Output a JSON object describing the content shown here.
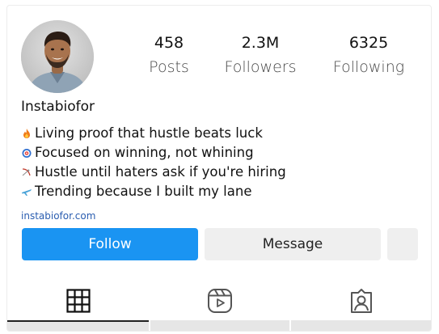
{
  "profile": {
    "username": "Instabiofor",
    "avatar_icon": "profile-photo",
    "stats": {
      "posts": {
        "value": "458",
        "label": "Posts"
      },
      "followers": {
        "value": "2.3M",
        "label": "Followers"
      },
      "following": {
        "value": "6325",
        "label": "Following"
      }
    },
    "bio": [
      {
        "emoji": "fire-icon",
        "text": "Living proof that hustle beats luck"
      },
      {
        "emoji": "target-icon",
        "text": "Focused on winning, not whining"
      },
      {
        "emoji": "bow-arrow-icon",
        "text": "Hustle until haters ask if you're hiring"
      },
      {
        "emoji": "airplane-icon",
        "text": "Trending because I built my lane"
      }
    ],
    "website": "instabiofor.com"
  },
  "actions": {
    "follow_label": "Follow",
    "message_label": "Message",
    "more_icon": "blank"
  },
  "tabs": [
    {
      "name": "posts-grid",
      "icon": "grid-icon",
      "active": true
    },
    {
      "name": "reels",
      "icon": "reels-icon",
      "active": false
    },
    {
      "name": "tagged",
      "icon": "tagged-person-icon",
      "active": false
    }
  ],
  "colors": {
    "primary": "#1a94f2",
    "secondary_button": "#efefef",
    "link": "#2a5db0"
  }
}
